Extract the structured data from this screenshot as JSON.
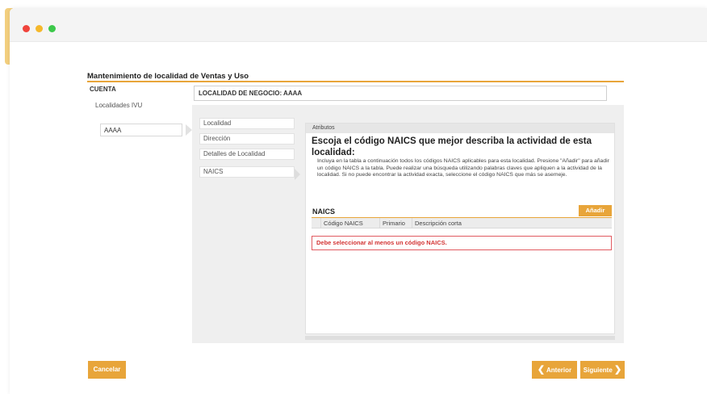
{
  "window": {
    "controls": [
      "close",
      "minimize",
      "maximize"
    ],
    "accent_color": "#e8a53a"
  },
  "page": {
    "title": "Mantenimiento de localidad de Ventas y Uso"
  },
  "left_nav": {
    "account_label": "CUENTA",
    "section_label": "Localidades IVU",
    "selected_item": "AAAA"
  },
  "business": {
    "label": "LOCALIDAD DE NEGOCIO: AAAA"
  },
  "steps": [
    {
      "label": "Localidad"
    },
    {
      "label": "Dirección"
    },
    {
      "label": "Detalles de Localidad"
    },
    {
      "label": "NAICS"
    }
  ],
  "content": {
    "section_bar": "Atributos",
    "heading": "Escoja el código NAICS que mejor describa la actividad de esta localidad:",
    "description": "Incluya en la tabla a continuación todos los códigos NAICS aplicables para esta localidad. Presione \"Añadir\" para añadir un código NAICS a la tabla. Puede realizar una búsqueda utilizando palabras claves que apliquen a la actividad de la localidad. Si no puede encontrar la actividad exacta, seleccione el código NAICS que más se asemeje.",
    "naics_title": "NAICS",
    "add_button": "Añadir",
    "table_headers": [
      "Código NAICS",
      "Primario",
      "Descripción corta"
    ],
    "error_message": "Debe seleccionar al menos un código NAICS."
  },
  "footer": {
    "cancel_label": "Cancelar",
    "prev_label": "Anterior",
    "next_label": "Siguiente",
    "prev_icon": "chevron-left-icon",
    "next_icon": "chevron-right-icon"
  }
}
